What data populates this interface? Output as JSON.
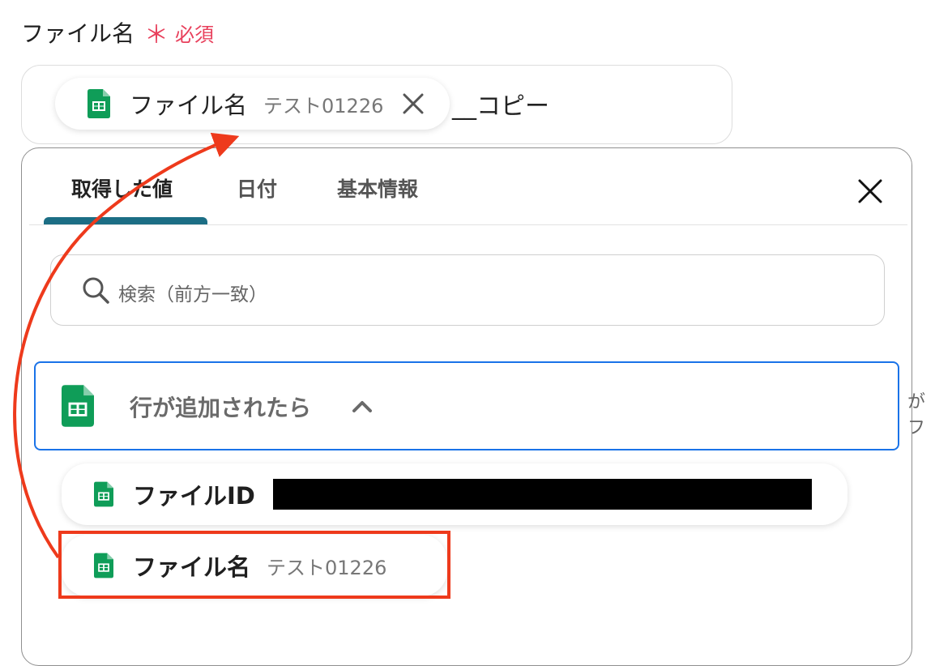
{
  "field": {
    "label": "ファイル名",
    "required_mark": "＊",
    "required_text": "必須"
  },
  "value_input": {
    "chip": {
      "icon": "google-sheets-icon",
      "label": "ファイル名",
      "value": "テスト01226"
    },
    "suffix": "__コピー"
  },
  "panel": {
    "tabs": [
      {
        "label": "取得した値",
        "active": true
      },
      {
        "label": "日付",
        "active": false
      },
      {
        "label": "基本情報",
        "active": false
      }
    ],
    "accent_color": "#1c6e85",
    "search": {
      "placeholder": "検索（前方一致）"
    },
    "group": {
      "icon": "google-sheets-icon",
      "title": "行が追加されたら",
      "expanded": true
    },
    "items": [
      {
        "label": "ファイルID",
        "value": "",
        "redacted": true
      },
      {
        "label": "ファイル名",
        "value": "テスト01226",
        "highlighted": true
      }
    ]
  },
  "side_clip_text": "がフ",
  "colors": {
    "required": "#e8405c",
    "highlight": "#ee3a1c",
    "group_border": "#1a73e8",
    "sheets_green": "#0f9d58"
  }
}
